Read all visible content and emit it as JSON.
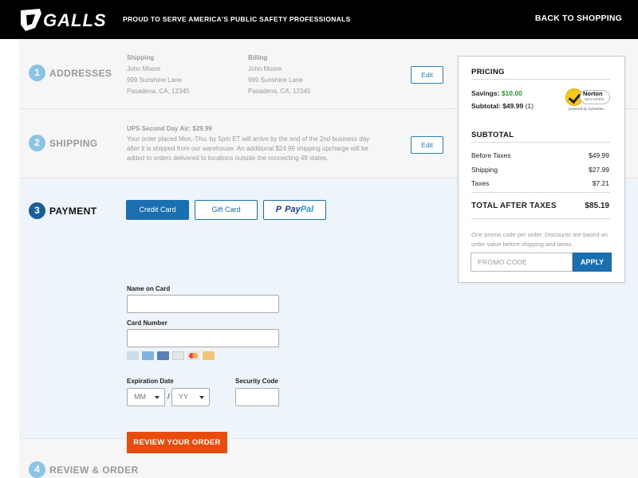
{
  "header": {
    "brand": "GALLS",
    "tagline": "PROUD TO SERVE AMERICA'S PUBLIC SAFETY PROFESSIONALS",
    "back_label": "BACK TO SHOPPING"
  },
  "steps": {
    "addresses": {
      "number": "1",
      "title": "ADDRESSES",
      "shipping": {
        "heading": "Shipping",
        "name": "John Moore",
        "street": "999 Sunshine Lane",
        "city": "Pasadena, CA, 12345"
      },
      "billing": {
        "heading": "Billing",
        "name": "John Moore",
        "street": "999 Sunshine Lane",
        "city": "Pasadena, CA, 12345"
      },
      "edit_label": "Edit"
    },
    "shipping": {
      "number": "2",
      "title": "SHIPPING",
      "method": "UPS Second Day Air: $29.99",
      "line1": "Your order placed Mon.-Thu. by 5pm ET will arrive by the end of the 2nd business day",
      "line2": "after it is shipped from our warehouse. An additional $24.99 shipping upcharge will be",
      "line3": "added to orders delivered to locations outside the connecting 48 states.",
      "edit_label": "Edit"
    },
    "payment": {
      "number": "3",
      "title": "PAYMENT",
      "tabs": {
        "credit_card": "Credit Card",
        "gift_card": "Gift Card",
        "paypal_a": "Pay",
        "paypal_b": "Pal"
      },
      "name_label": "Name on Card",
      "card_number_label": "Card Number",
      "expiration_label": "Expiration Date",
      "month_value": "MM",
      "year_value": "YY",
      "separator": "/",
      "security_label": "Security Code",
      "submit_label": "REVIEW YOUR ORDER"
    },
    "review": {
      "number": "4",
      "title": "REVIEW & ORDER"
    }
  },
  "summary": {
    "pricing_heading": "PRICING",
    "savings_label": "Savings:",
    "savings_value": "$10.00",
    "subtotal_label": "Subtotal:",
    "subtotal_value": "$49.99",
    "subtotal_count": "(1)",
    "norton": {
      "word": "Norton",
      "secured": "SECURED",
      "powered": "powered by Symantec"
    },
    "subtotal_heading": "SUBTOTAL",
    "before_taxes_label": "Before Taxes",
    "before_taxes_value": "$49.99",
    "shipping_label": "Shipping",
    "shipping_value": "$27.99",
    "taxes_label": "Taxes",
    "taxes_value": "$7.21",
    "total_label": "TOTAL AFTER TAXES",
    "total_value": "$85.19",
    "promo_note": "One promo code per order. Discounts are based on order value before shipping and taxes.",
    "promo_placeholder": "PROMO CODE",
    "apply_label": "APPLY"
  },
  "colors": {
    "accent_blue": "#1a6fb0",
    "cta_orange": "#e84c0d",
    "savings_green": "#2b9a2b"
  },
  "icons": [
    "galls-logo",
    "norton-secured-badge",
    "amex-card-icon",
    "visa-card-icon",
    "discover-card-icon",
    "mastercard-icon",
    "paypal-logo",
    "dropdown-caret-icon"
  ]
}
